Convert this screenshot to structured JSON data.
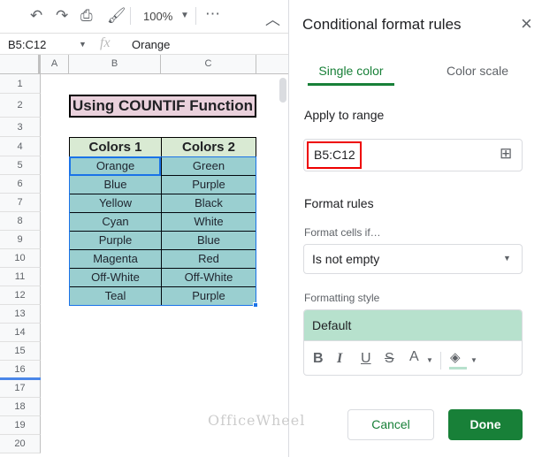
{
  "toolbar": {
    "zoom": "100%",
    "icons": [
      "undo-icon",
      "redo-icon",
      "print-icon",
      "paint-format-icon",
      "more-icon",
      "collapse-icon"
    ]
  },
  "formula_bar": {
    "name_box": "B5:C12",
    "fx": "fx",
    "value": "Orange"
  },
  "columns": [
    "A",
    "B",
    "C"
  ],
  "rows": [
    "1",
    "2",
    "3",
    "4",
    "5",
    "6",
    "7",
    "8",
    "9",
    "10",
    "11",
    "12",
    "13",
    "14",
    "15",
    "16",
    "17",
    "18",
    "19",
    "20"
  ],
  "sheet": {
    "title": "Using COUNTIF Function",
    "headers": [
      "Colors 1",
      "Colors 2"
    ],
    "data": [
      [
        "Orange",
        "Green"
      ],
      [
        "Blue",
        "Purple"
      ],
      [
        "Yellow",
        "Black"
      ],
      [
        "Cyan",
        "White"
      ],
      [
        "Purple",
        "Blue"
      ],
      [
        "Magenta",
        "Red"
      ],
      [
        "Off-White",
        "Off-White"
      ],
      [
        "Teal",
        "Purple"
      ]
    ]
  },
  "panel": {
    "title": "Conditional format rules",
    "close": "×",
    "tabs": [
      "Single color",
      "Color scale"
    ],
    "apply_label": "Apply to range",
    "range": "B5:C12",
    "format_rules": "Format rules",
    "format_cells_if": "Format cells if…",
    "condition": "Is not empty",
    "formatting_style": "Formatting style",
    "style_preview": "Default",
    "style_buttons": [
      "B",
      "I",
      "U",
      "S",
      "A"
    ],
    "cancel": "Cancel",
    "done": "Done"
  },
  "watermark": "OfficeWheel",
  "colors": {
    "accent": "#188038",
    "cell": "#a2d5cf",
    "header": "#d9ead3",
    "title": "#ead1dc",
    "preview": "#b7e1cd"
  }
}
